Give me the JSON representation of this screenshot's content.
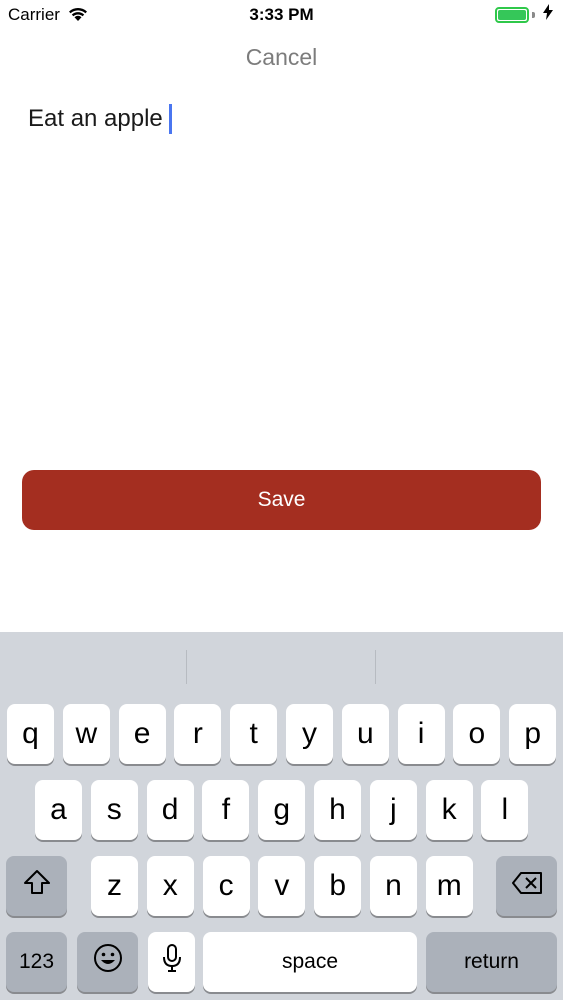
{
  "status_bar": {
    "carrier": "Carrier",
    "time": "3:33 PM",
    "battery_color": "#35c759",
    "wifi_icon": "wifi-icon",
    "charging_icon": "bolt-icon"
  },
  "nav": {
    "cancel_label": "Cancel"
  },
  "editor": {
    "value": "Eat an apple"
  },
  "save": {
    "label": "Save",
    "color": "#a42e20"
  },
  "keyboard": {
    "row1": [
      "q",
      "w",
      "e",
      "r",
      "t",
      "y",
      "u",
      "i",
      "o",
      "p"
    ],
    "row2": [
      "a",
      "s",
      "d",
      "f",
      "g",
      "h",
      "j",
      "k",
      "l"
    ],
    "row3": [
      "z",
      "x",
      "c",
      "v",
      "b",
      "n",
      "m"
    ],
    "numbers_label": "123",
    "space_label": "space",
    "return_label": "return",
    "shift_icon": "shift-icon",
    "delete_icon": "backspace-icon",
    "emoji_icon": "emoji-icon",
    "mic_icon": "microphone-icon"
  }
}
